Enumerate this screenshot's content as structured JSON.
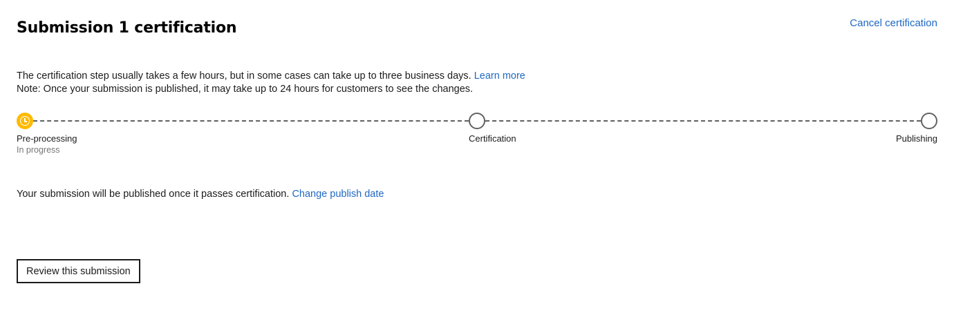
{
  "header": {
    "title": "Submission 1 certification",
    "cancel_link": "Cancel certification"
  },
  "intro": {
    "line1": "The certification step usually takes a few hours, but in some cases can take up to three business days.",
    "learn_more": "Learn more",
    "line2": "Note: Once your submission is published, it may take up to 24 hours for customers to see the changes."
  },
  "steps": [
    {
      "label": "Pre-processing",
      "status": "In progress",
      "state": "active",
      "icon": "clock-icon"
    },
    {
      "label": "Certification",
      "status": "",
      "state": "pending"
    },
    {
      "label": "Publishing",
      "status": "",
      "state": "pending"
    }
  ],
  "publish": {
    "text": "Your submission will be published once it passes certification.",
    "change_link": "Change publish date"
  },
  "actions": {
    "review_label": "Review this submission"
  },
  "colors": {
    "accent_link": "#1f68c4",
    "active_step": "#ffba00",
    "pending_step_border": "#616161"
  }
}
